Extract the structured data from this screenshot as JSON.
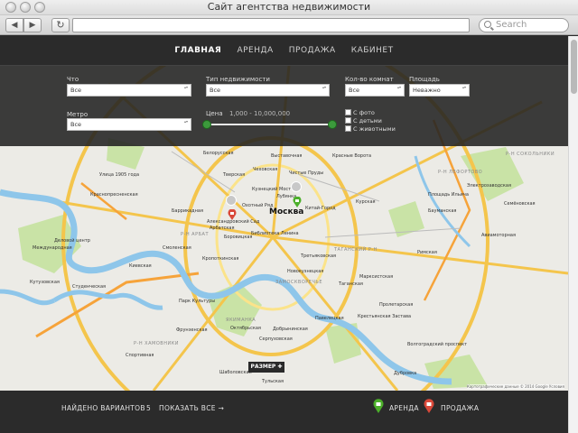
{
  "window": {
    "title": "Сайт агентства недвижимости"
  },
  "browser": {
    "search_placeholder": "Search",
    "back": "◀",
    "forward": "▶",
    "reload": "↻"
  },
  "nav": {
    "items": [
      {
        "label": "ГЛАВНАЯ",
        "active": true
      },
      {
        "label": "АРЕНДА"
      },
      {
        "label": "ПРОДАЖА"
      },
      {
        "label": "КАБИНЕТ"
      }
    ]
  },
  "filters": {
    "what": {
      "label": "Что",
      "value": "Все"
    },
    "type": {
      "label": "Тип недвижимости",
      "value": "Все"
    },
    "rooms": {
      "label": "Кол-во комнат",
      "value": "Все"
    },
    "area": {
      "label": "Площадь",
      "value": "Неважно"
    },
    "metro": {
      "label": "Метро",
      "value": "Все"
    },
    "price": {
      "label": "Цена",
      "range": "1,000 - 10,000,000"
    },
    "checkboxes": [
      "С фото",
      "С детьми",
      "С животными"
    ]
  },
  "map": {
    "city": "Москва",
    "size_button": "РАЗМЕР ✚",
    "copyright": "Картографические данные © 2014 Google   Условия",
    "districts": [
      "Р-Н АРБАТ",
      "ЗАМОСКВОРЕЧЬЕ",
      "ТАГАНСКИЙ Р-Н",
      "Р-Н ЛЕФОРТОВО",
      "Р-Н ХАМОВНИКИ",
      "Р-Н СОКОЛЬНИКИ",
      "ЯКИМАНКА"
    ],
    "labels": [
      "Улица 1905 года",
      "Белорусская",
      "Тверская",
      "Чеховская",
      "Чистые Пруды",
      "Красные Ворота",
      "Краснопресненская",
      "Кузнецкий Мост",
      "Лубянка",
      "Охотный Ряд",
      "Китай-Город",
      "Курская",
      "Баррикадная",
      "Александровский Сад",
      "Арбатская",
      "Боровицкая",
      "Библиотека Ленина",
      "Площадь Ильича",
      "Деловой центр",
      "Международная",
      "Смоленская",
      "Киевская",
      "Кропоткинская",
      "Третьяковская",
      "Новокузнецкая",
      "Таганская",
      "Марксистская",
      "Пролетарская",
      "Кутузовская",
      "Студенческая",
      "Парк Культуры",
      "Октябрьская",
      "Добрынинская",
      "Павелецкая",
      "Фрунзенская",
      "Спортивная",
      "Серпуховская",
      "Шаболовская",
      "Тульская",
      "Крестьянская Застава",
      "Римская",
      "Авиамоторная",
      "Бауманская",
      "Электрозаводская",
      "Дубровка",
      "Волгоградский проспект",
      "Семёновская",
      "Выставочная"
    ]
  },
  "footer": {
    "found_label": "НАЙДЕНО ВАРИАНТОВ",
    "found_count": "5",
    "show_all": "ПОКАЗАТЬ ВСЕ →",
    "legend_rent": "АРЕНДА",
    "legend_sale": "ПРОДАЖА"
  },
  "colors": {
    "dark": "#2b2b2b",
    "rent": "#4caf2a",
    "sale": "#d9493a",
    "river": "#8ec6ea",
    "road": "#f4c54c",
    "park": "#c9e3a6"
  }
}
